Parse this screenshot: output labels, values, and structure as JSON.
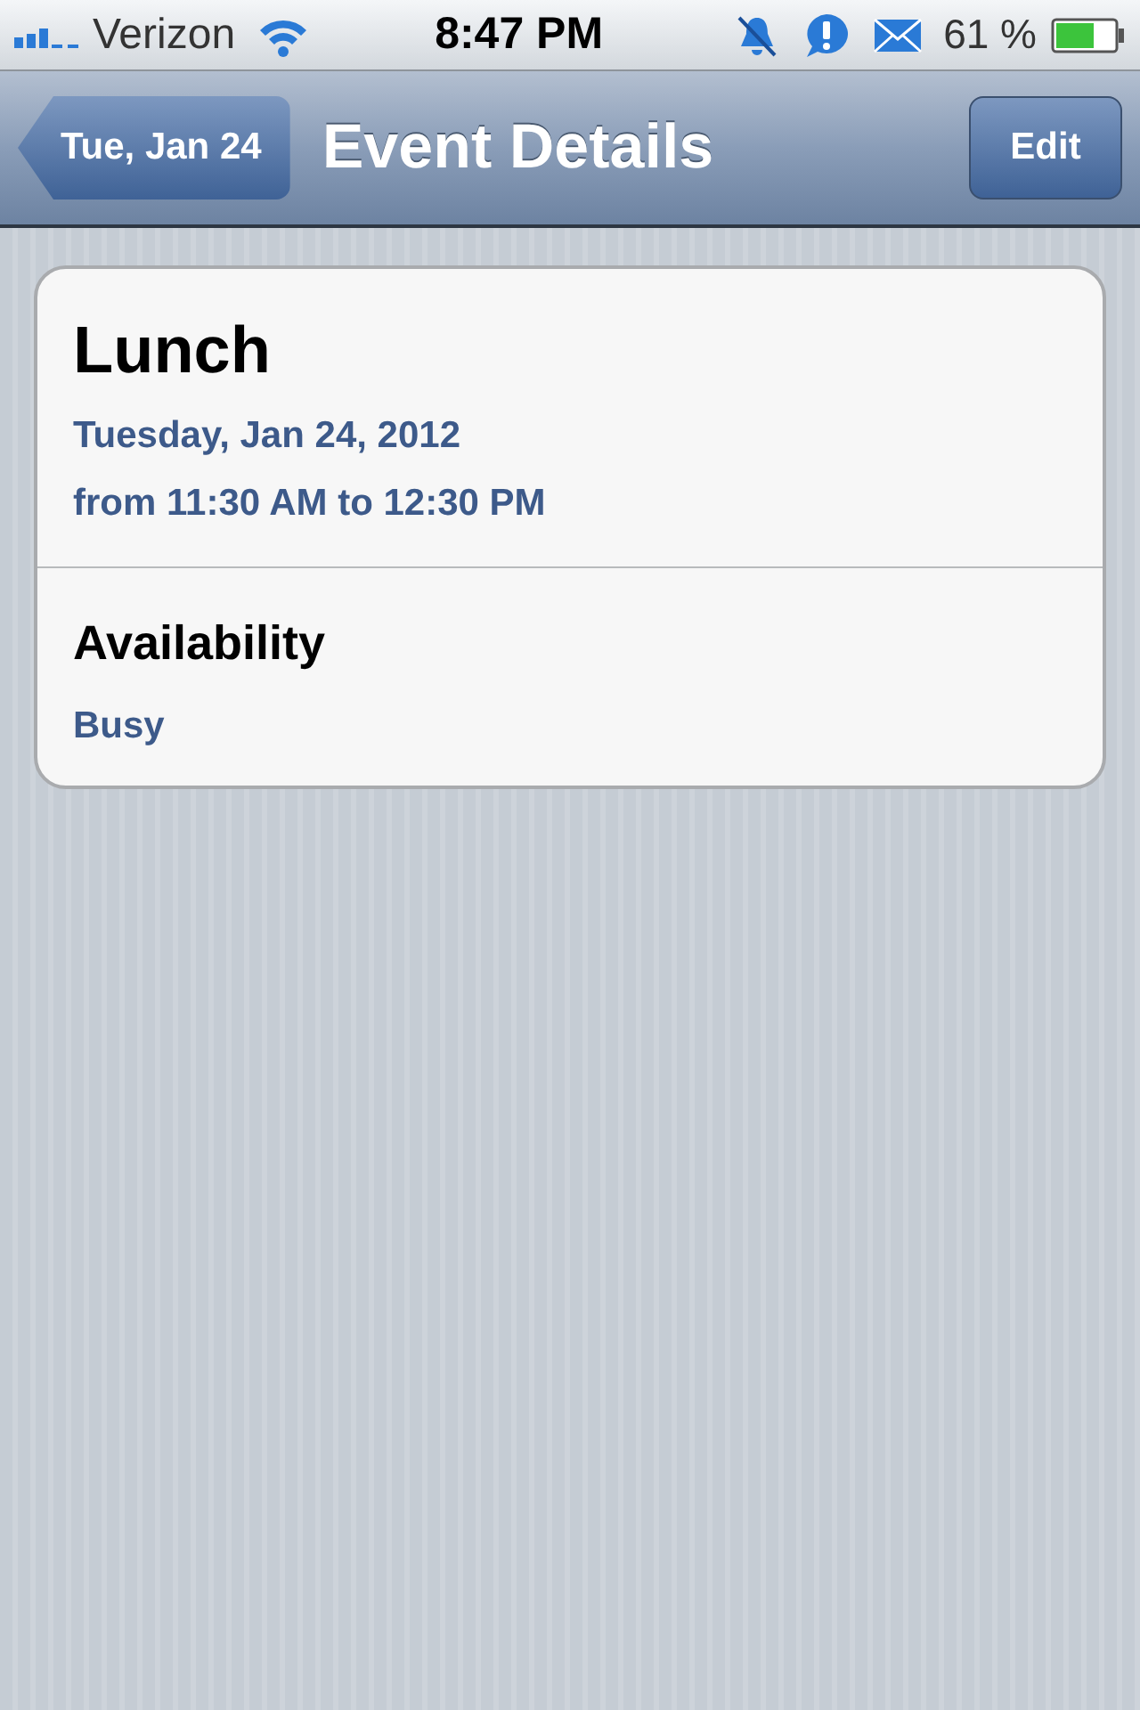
{
  "status_bar": {
    "carrier": "Verizon",
    "time": "8:47 PM",
    "battery": "61 %"
  },
  "nav_bar": {
    "back": "Tue, Jan 24",
    "title": "Event Details",
    "action": "Edit"
  },
  "event": {
    "title": "Lunch",
    "date": "Tuesday, Jan 24, 2012",
    "time": "from 11:30 AM to 12:30 PM"
  },
  "availability": {
    "label": "Availability",
    "value": "Busy"
  }
}
